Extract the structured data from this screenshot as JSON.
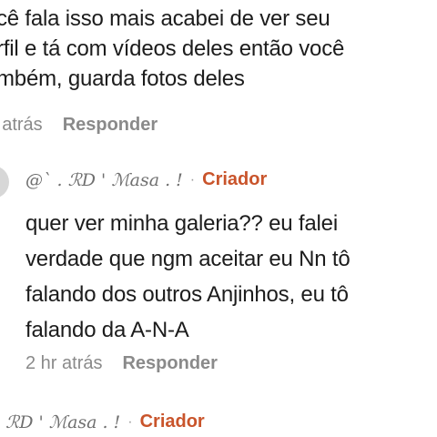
{
  "top_comment": {
    "text": "cê fala isso mais acabei de ver seu\nrfil e tá com vídeos deles então você\nmbém, guarda fotos deles",
    "time": "r atrás",
    "reply_label": "Responder"
  },
  "reply_comment": {
    "author": "@` . ℛD ' ℳasa . !",
    "separator": "·",
    "creator_badge": "Criador",
    "text": "quer ver minha galeria?? eu falei\nverdade que ngm aceitar eu Nn tô\nfalando dos outros Anjinhos, eu tô\nfalando da A-N-A",
    "time": "2 hr atrás",
    "reply_label": "Responder"
  },
  "next_comment": {
    "author": ". ℛD ' ℳasa . !",
    "separator": "·",
    "creator_badge": "Criador"
  },
  "colors": {
    "creator_accent": "#c9542b",
    "meta_gray": "#8a8a8a"
  }
}
